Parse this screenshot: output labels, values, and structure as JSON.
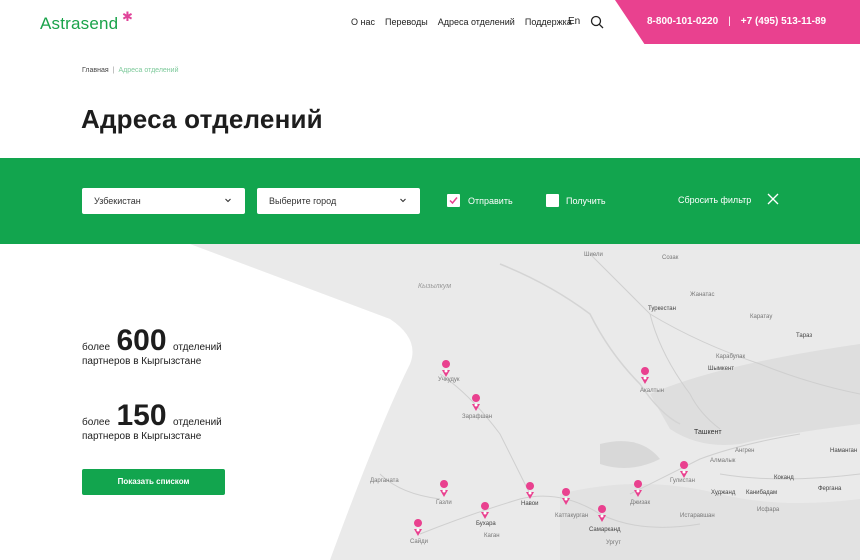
{
  "header": {
    "logo": "Astrasend",
    "nav": [
      "О нас",
      "Переводы",
      "Адреса отделений",
      "Поддержка"
    ],
    "lang": "En",
    "phone1": "8-800-101-0220",
    "phone_sep": "|",
    "phone2": "+7 (495) 513-11-89",
    "accent": "#e9418f",
    "brand": "#12a54e"
  },
  "breadcrumb": {
    "home": "Главная",
    "divider": "|",
    "current": "Адреса отделений"
  },
  "page_title": "Адреса отделений",
  "filters": {
    "country": "Узбекистан",
    "city_placeholder": "Выберите город",
    "send_label": "Отправить",
    "send_checked": true,
    "receive_label": "Получить",
    "receive_checked": false,
    "reset_label": "Сбросить фильтр"
  },
  "stats": [
    {
      "pre": "более",
      "num": "600",
      "post": "отделений",
      "line2": "партнеров в Кыргызстане"
    },
    {
      "pre": "более",
      "num": "150",
      "post": "отделений",
      "line2": "партнеров в Кыргызстане"
    }
  ],
  "list_button": "Показать списком",
  "map": {
    "labels": [
      "Шиели",
      "Созак",
      "Кызылкум",
      "Жанатас",
      "Туркестан",
      "Каратау",
      "Тараз",
      "Карабулак",
      "Шымкент",
      "Учкудук",
      "Зарафшан",
      "Акалтын",
      "Ташкент",
      "Ангрен",
      "Наманган",
      "Алмалык",
      "Гулистан",
      "Коканд",
      "Худжанд",
      "Канибадам",
      "Фергана",
      "Джизак",
      "Газли",
      "Бухара",
      "Навои",
      "Каттакурган",
      "Самарканд",
      "Истаравшан",
      "Исфара",
      "Каган",
      "Сайди",
      "Ургут",
      "Дарганата"
    ]
  }
}
